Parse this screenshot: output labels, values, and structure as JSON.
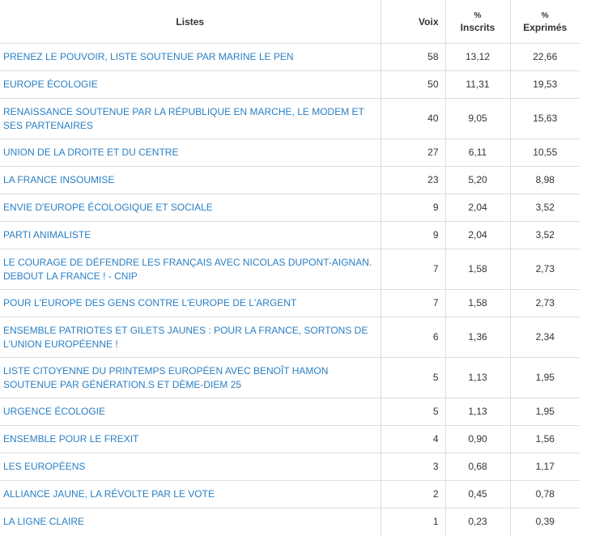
{
  "table": {
    "headers": {
      "list": "Listes",
      "voix": "Voix",
      "inscrits_pct": "%",
      "inscrits_label": "Inscrits",
      "exprimes_pct": "%",
      "exprimes_label": "Exprimés"
    },
    "rows": [
      {
        "name": "PRENEZ LE POUVOIR, LISTE SOUTENUE PAR MARINE LE PEN",
        "voix": "58",
        "inscrits": "13,12",
        "exprimes": "22,66"
      },
      {
        "name": "EUROPE ÉCOLOGIE",
        "voix": "50",
        "inscrits": "11,31",
        "exprimes": "19,53"
      },
      {
        "name": "RENAISSANCE SOUTENUE PAR LA RÉPUBLIQUE EN MARCHE, LE MODEM ET SES PARTENAIRES",
        "voix": "40",
        "inscrits": "9,05",
        "exprimes": "15,63"
      },
      {
        "name": "UNION DE LA DROITE ET DU CENTRE",
        "voix": "27",
        "inscrits": "6,11",
        "exprimes": "10,55"
      },
      {
        "name": "LA FRANCE INSOUMISE",
        "voix": "23",
        "inscrits": "5,20",
        "exprimes": "8,98"
      },
      {
        "name": "ENVIE D'EUROPE ÉCOLOGIQUE ET SOCIALE",
        "voix": "9",
        "inscrits": "2,04",
        "exprimes": "3,52"
      },
      {
        "name": "PARTI ANIMALISTE",
        "voix": "9",
        "inscrits": "2,04",
        "exprimes": "3,52"
      },
      {
        "name": "LE COURAGE DE DÉFENDRE LES FRANÇAIS AVEC NICOLAS DUPONT-AIGNAN. DEBOUT LA FRANCE ! - CNIP",
        "voix": "7",
        "inscrits": "1,58",
        "exprimes": "2,73"
      },
      {
        "name": "POUR L'EUROPE DES GENS CONTRE L'EUROPE DE L'ARGENT",
        "voix": "7",
        "inscrits": "1,58",
        "exprimes": "2,73"
      },
      {
        "name": "ENSEMBLE PATRIOTES ET GILETS JAUNES : POUR LA FRANCE, SORTONS DE L'UNION EUROPÉENNE !",
        "voix": "6",
        "inscrits": "1,36",
        "exprimes": "2,34"
      },
      {
        "name": "LISTE CITOYENNE DU PRINTEMPS EUROPÉEN AVEC BENOÎT HAMON SOUTENUE PAR GÉNÉRATION.S ET DÈME-DIEM 25",
        "voix": "5",
        "inscrits": "1,13",
        "exprimes": "1,95"
      },
      {
        "name": "URGENCE ÉCOLOGIE",
        "voix": "5",
        "inscrits": "1,13",
        "exprimes": "1,95"
      },
      {
        "name": "ENSEMBLE POUR LE FREXIT",
        "voix": "4",
        "inscrits": "0,90",
        "exprimes": "1,56"
      },
      {
        "name": "LES EUROPÉENS",
        "voix": "3",
        "inscrits": "0,68",
        "exprimes": "1,17"
      },
      {
        "name": "ALLIANCE JAUNE, LA RÉVOLTE PAR LE VOTE",
        "voix": "2",
        "inscrits": "0,45",
        "exprimes": "0,78"
      },
      {
        "name": "LA LIGNE CLAIRE",
        "voix": "1",
        "inscrits": "0,23",
        "exprimes": "0,39"
      }
    ]
  },
  "colors": {
    "link": "#2a7fc4",
    "border": "#dddddd",
    "text": "#333333"
  }
}
